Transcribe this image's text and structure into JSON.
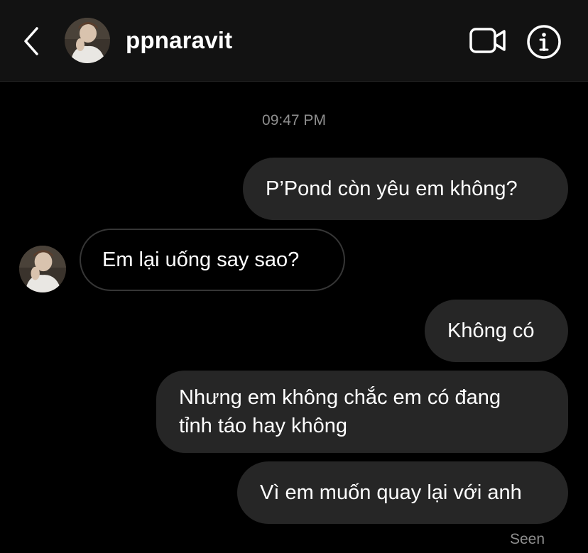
{
  "header": {
    "username": "ppnaravit"
  },
  "icons": {
    "back": "chevron-left-icon",
    "video": "video-camera-icon",
    "info": "info-circle-icon"
  },
  "colors": {
    "background": "#000000",
    "header_background": "#121212",
    "outgoing_bubble": "#262626",
    "incoming_border": "#363636",
    "muted_text": "#8e8e8e"
  },
  "thread": {
    "timestamp": "09:47 PM",
    "messages": [
      {
        "direction": "outgoing",
        "text": "P’Pond còn yêu em không?"
      },
      {
        "direction": "incoming",
        "text": "Em lại uống say sao?"
      },
      {
        "direction": "outgoing",
        "text": "Không có"
      },
      {
        "direction": "outgoing",
        "lines": [
          "Nhưng em không chắc em có đang",
          "tỉnh táo hay không"
        ]
      },
      {
        "direction": "outgoing",
        "text": "Vì em muốn quay lại với anh"
      }
    ],
    "status": "Seen"
  }
}
